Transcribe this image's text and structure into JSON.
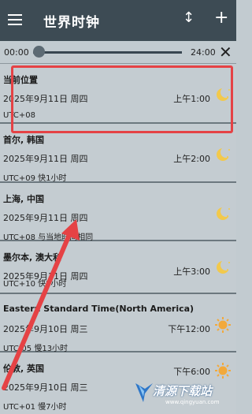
{
  "header": {
    "title": "世界时钟",
    "menu_icon": "hamburger-menu-icon",
    "sort_icon": "sort-arrows-icon",
    "add_icon": "plus-icon"
  },
  "slider": {
    "start_label": "00:00",
    "end_label": "24:00",
    "value": 0.0,
    "close_icon": "close-icon"
  },
  "clocks": [
    {
      "city": "当前位置",
      "date": "2025年9月11日 周四",
      "utc": "UTC+08",
      "time": "上午1:00",
      "icon": "moon-night-icon"
    },
    {
      "city": "首尔, 韩国",
      "date": "2025年9月11日 周四",
      "utc": "UTC+09  快1小时",
      "time": "上午2:00",
      "icon": "moon-night-icon"
    },
    {
      "city": "上海, 中国",
      "date": "2025年9月11日 周四",
      "utc": "UTC+08  与当地时间相同",
      "time": "",
      "icon": "moon-night-icon"
    },
    {
      "city": "墨尔本, 澳大利",
      "date": "2025年9月11日 周四",
      "utc": "UTC+10  快2小时",
      "time": "上午3:00",
      "icon": "moon-night-icon"
    },
    {
      "city": "Eastern Standard Time(North America)",
      "date": "2025年9月10日 周三",
      "utc": "UTC-05  慢13小时",
      "time": "下午12:00",
      "icon": "sun-day-icon"
    },
    {
      "city": "伦敦, 英国",
      "date": "2025年9月10日 周三",
      "utc": "UTC+01  慢7小时",
      "time": "下午6:00",
      "icon": "sun-day-icon"
    }
  ],
  "watermark": {
    "brand": "清源下载站",
    "url": "www.qingyuan.com"
  },
  "colors": {
    "header_bg": "#3d4b54",
    "card_bg": "#c4ccd1",
    "highlight": "#e54245",
    "arrow": "#e54245",
    "moon": "#f2c94c",
    "sun": "#f2a93b"
  }
}
